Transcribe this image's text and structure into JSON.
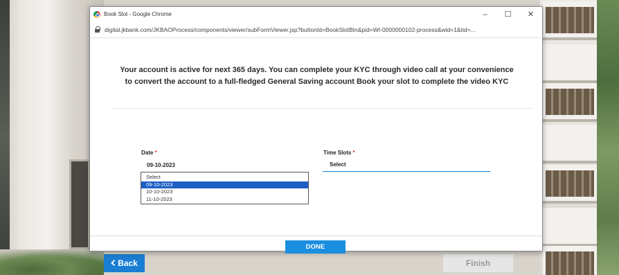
{
  "window": {
    "title": "Book Slot - Google Chrome",
    "url": "digital.jkbank.com/JKBAOProcess/components/viewer/subFormViewer.jsp?buttonId=BookSlotBtn&pid=WI-0000000102-process&wid=1&tid=...",
    "controls": {
      "minimize": "–",
      "maximize": "☐",
      "close": "✕"
    }
  },
  "message": "Your account is active for next 365 days. You can complete your KYC through video call at your convenience to convert the account to a full-fledged General Saving account Book your slot to complete the video KYC",
  "form": {
    "date": {
      "label": "Date",
      "required_mark": "*",
      "value": "09-10-2023",
      "options": [
        "Select",
        "09-10-2023",
        "10-10-2023",
        "11-10-2023"
      ],
      "highlighted_option": "09-10-2023"
    },
    "time_slots": {
      "label": "Time Slots",
      "required_mark": "*",
      "value": "Select"
    },
    "done_label": "DONE"
  },
  "page": {
    "back_label": "Back",
    "back_icon": "chevron-left-icon",
    "finish_label": "Finish"
  },
  "colors": {
    "accent": "#1a8ee0",
    "highlight": "#1e5fc4",
    "required": "#e03030"
  }
}
